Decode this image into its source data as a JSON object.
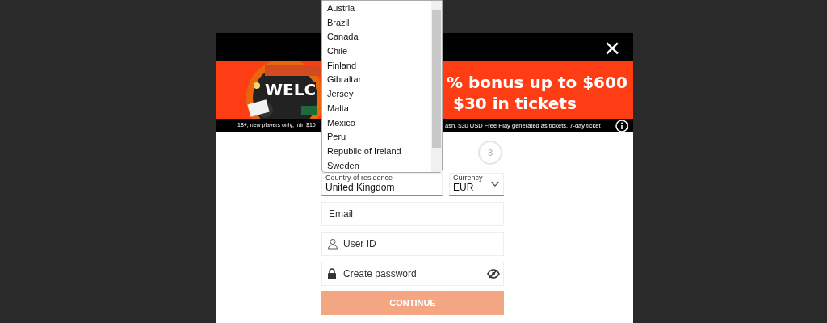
{
  "modal": {
    "close": "×"
  },
  "banner": {
    "art_text": "WELC",
    "headline_lines": [
      "% bonus up to $600",
      "$30 in tickets"
    ],
    "disclaimer_left": "18+; new players only; min $10",
    "disclaimer_right": "ash. $30 USD Free Play generated as tickets. 7-day ticket"
  },
  "steps": [
    {
      "label": "3"
    }
  ],
  "country": {
    "label": "Country of residence",
    "value": "United Kingdom"
  },
  "currency": {
    "label": "Currency",
    "value": "EUR"
  },
  "fields": [
    {
      "kind": "email",
      "placeholder": "Email"
    },
    {
      "kind": "user",
      "placeholder": "User ID"
    },
    {
      "kind": "password",
      "placeholder": "Create password"
    }
  ],
  "button": {
    "label": "CONTINUE",
    "disabled": true
  },
  "dropdown": {
    "options": [
      {
        "label": "Austria",
        "selected": false
      },
      {
        "label": "Brazil",
        "selected": false
      },
      {
        "label": "Canada",
        "selected": false
      },
      {
        "label": "Chile",
        "selected": false
      },
      {
        "label": "Finland",
        "selected": false
      },
      {
        "label": "Gibraltar",
        "selected": false
      },
      {
        "label": "Jersey",
        "selected": false
      },
      {
        "label": "Malta",
        "selected": false
      },
      {
        "label": "Mexico",
        "selected": false
      },
      {
        "label": "Peru",
        "selected": false
      },
      {
        "label": "Republic of Ireland",
        "selected": false
      },
      {
        "label": "Sweden",
        "selected": false
      }
    ]
  }
}
